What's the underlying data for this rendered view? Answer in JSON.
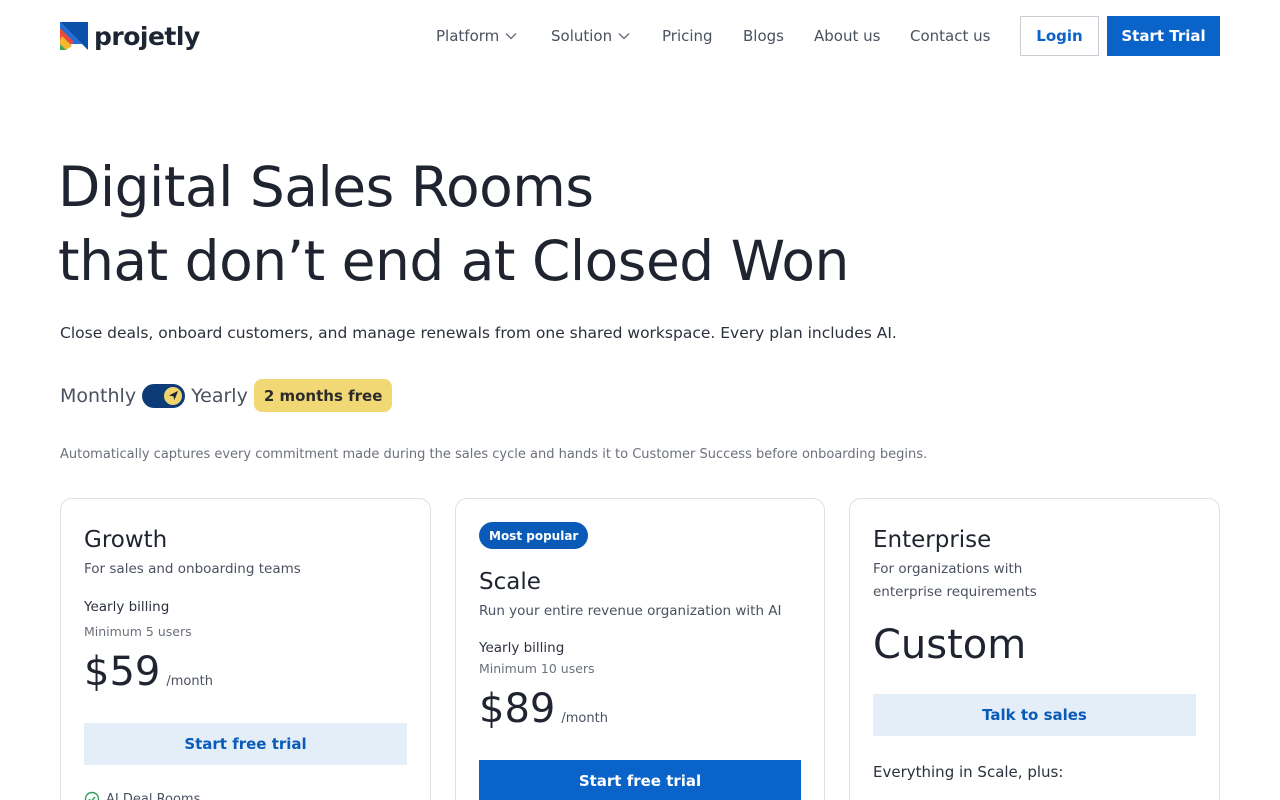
{
  "brand": {
    "name": "projetly"
  },
  "nav": {
    "platform": "Platform",
    "solution": "Solution",
    "pricing": "Pricing",
    "blogs": "Blogs",
    "about": "About us",
    "contact": "Contact us"
  },
  "header_actions": {
    "login": "Login",
    "start_trial": "Start Trial"
  },
  "hero": {
    "title_line1": "Digital Sales Rooms",
    "title_line2": "that don’t end at Closed Won",
    "subtitle": "Close deals, onboard customers, and manage renewals from one shared workspace. Every plan includes AI.",
    "note": "Automatically captures every commitment made during the sales cycle and hands it to Customer Success before onboarding begins."
  },
  "billing_toggle": {
    "monthly_label": "Monthly",
    "yearly_label": "Yearly",
    "selected": "Yearly",
    "badge": "2 months free"
  },
  "plans": {
    "growth": {
      "name": "Growth",
      "description": "For sales and onboarding teams",
      "billing": "Yearly billing",
      "minimum": "Minimum 5 users",
      "price": "$59",
      "per": "/month",
      "cta": "Start free trial",
      "feature_1": "AI Deal Rooms"
    },
    "scale": {
      "badge": "Most popular",
      "name": "Scale",
      "description": "Run your entire revenue organization with AI",
      "billing": "Yearly billing",
      "minimum": "Minimum 10 users",
      "price": "$89",
      "per": "/month",
      "cta": "Start free trial"
    },
    "enterprise": {
      "name": "Enterprise",
      "description_line1": "For organizations with",
      "description_line2": "enterprise requirements",
      "price": "Custom",
      "cta": "Talk to sales",
      "includes": "Everything in Scale, plus:"
    }
  },
  "colors": {
    "primary": "#0a63c9",
    "primary_light": "#e4eef9",
    "badge_yellow": "#f2d874",
    "toggle_dark": "#0d3b78",
    "text_dark": "#1f2430"
  },
  "icons": {
    "nav_dropdown": "chevron-down-icon",
    "toggle_knob": "paper-plane-icon",
    "feature_check": "check-circle-icon"
  }
}
